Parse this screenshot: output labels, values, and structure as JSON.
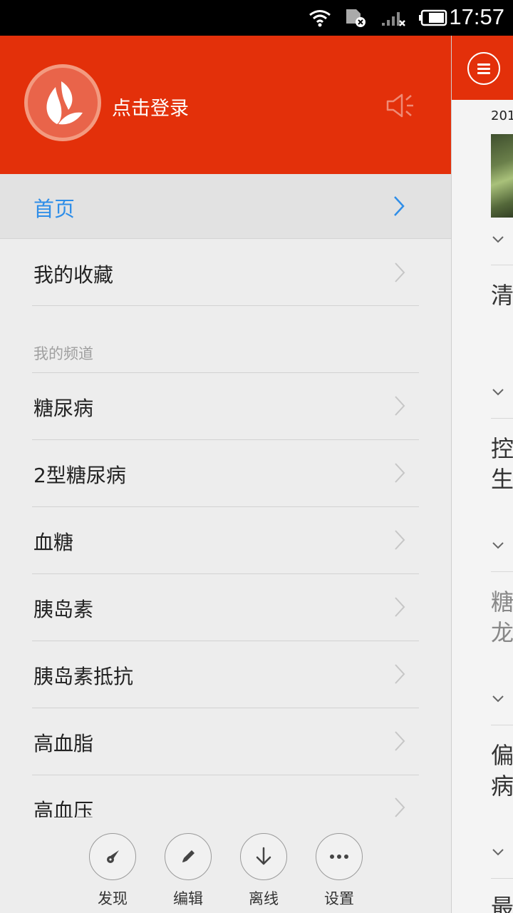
{
  "status_bar": {
    "time": "17:57"
  },
  "drawer": {
    "login_label": "点击登录",
    "home": {
      "label": "首页"
    },
    "favorites": {
      "label": "我的收藏"
    },
    "channels_title": "我的频道",
    "channels": [
      {
        "label": "糖尿病"
      },
      {
        "label": "2型糖尿病"
      },
      {
        "label": "血糖"
      },
      {
        "label": "胰岛素"
      },
      {
        "label": "胰岛素抵抗"
      },
      {
        "label": "高血脂"
      },
      {
        "label": "高血压"
      }
    ],
    "toolbar": [
      {
        "label": "发现",
        "icon": "compass-icon"
      },
      {
        "label": "编辑",
        "icon": "pencil-icon"
      },
      {
        "label": "离线",
        "icon": "download-icon"
      },
      {
        "label": "设置",
        "icon": "more-icon"
      }
    ]
  },
  "right_panel": {
    "date_fragment": "201",
    "title_fragments": [
      "清",
      "控",
      "生",
      "糖",
      "龙",
      "偏",
      "病",
      "最"
    ]
  },
  "colors": {
    "accent": "#e3300a",
    "active_link": "#2f8ee8"
  }
}
